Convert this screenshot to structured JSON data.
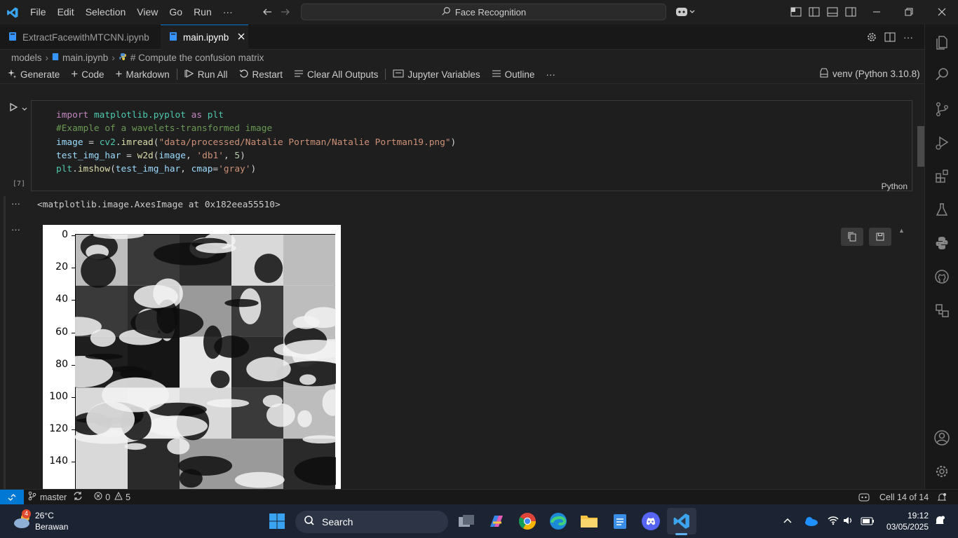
{
  "menu": [
    "File",
    "Edit",
    "Selection",
    "View",
    "Go",
    "Run",
    "···"
  ],
  "search": {
    "text": "Face Recognition"
  },
  "tabs": [
    {
      "label": "ExtractFacewithMTCNN.ipynb"
    },
    {
      "label": "main.ipynb"
    }
  ],
  "breadcrumb": {
    "folder": "models",
    "file": "main.ipynb",
    "cell": "# Compute the confusion matrix"
  },
  "toolbar": {
    "generate": "Generate",
    "code": "Code",
    "markdown": "Markdown",
    "run_all": "Run All",
    "restart": "Restart",
    "clear_outputs": "Clear All Outputs",
    "jupyter_variables": "Jupyter Variables",
    "outline": "Outline",
    "more": "···",
    "kernel": "venv (Python 3.10.8)"
  },
  "cell": {
    "exec_count": "[7]",
    "language": "Python",
    "lines": [
      "import matplotlib.pyplot as plt",
      "#Example of a wavelets-transformed image",
      "image = cv2.imread(\"data/processed/Natalie Portman/Natalie Portman19.png\")",
      "test_img_har = w2d(image, 'db1', 5)",
      "plt.imshow(test_img_har, cmap='gray')"
    ],
    "output_text": "<matplotlib.image.AxesImage at 0x182eea55510>",
    "more_label": "···"
  },
  "chart_data": {
    "type": "image",
    "y_tick_labels": [
      "0",
      "20",
      "40",
      "60",
      "80",
      "100",
      "120",
      "140"
    ],
    "colormap": "gray"
  },
  "statusbar": {
    "branch": "master",
    "errors": "0",
    "warnings": "5",
    "cell_position": "Cell 14 of 14"
  },
  "taskbar": {
    "weather_temp": "26°C",
    "weather_desc": "Berawan",
    "weather_badge": "4",
    "search": "Search",
    "time": "19:12",
    "date": "03/05/2025"
  }
}
